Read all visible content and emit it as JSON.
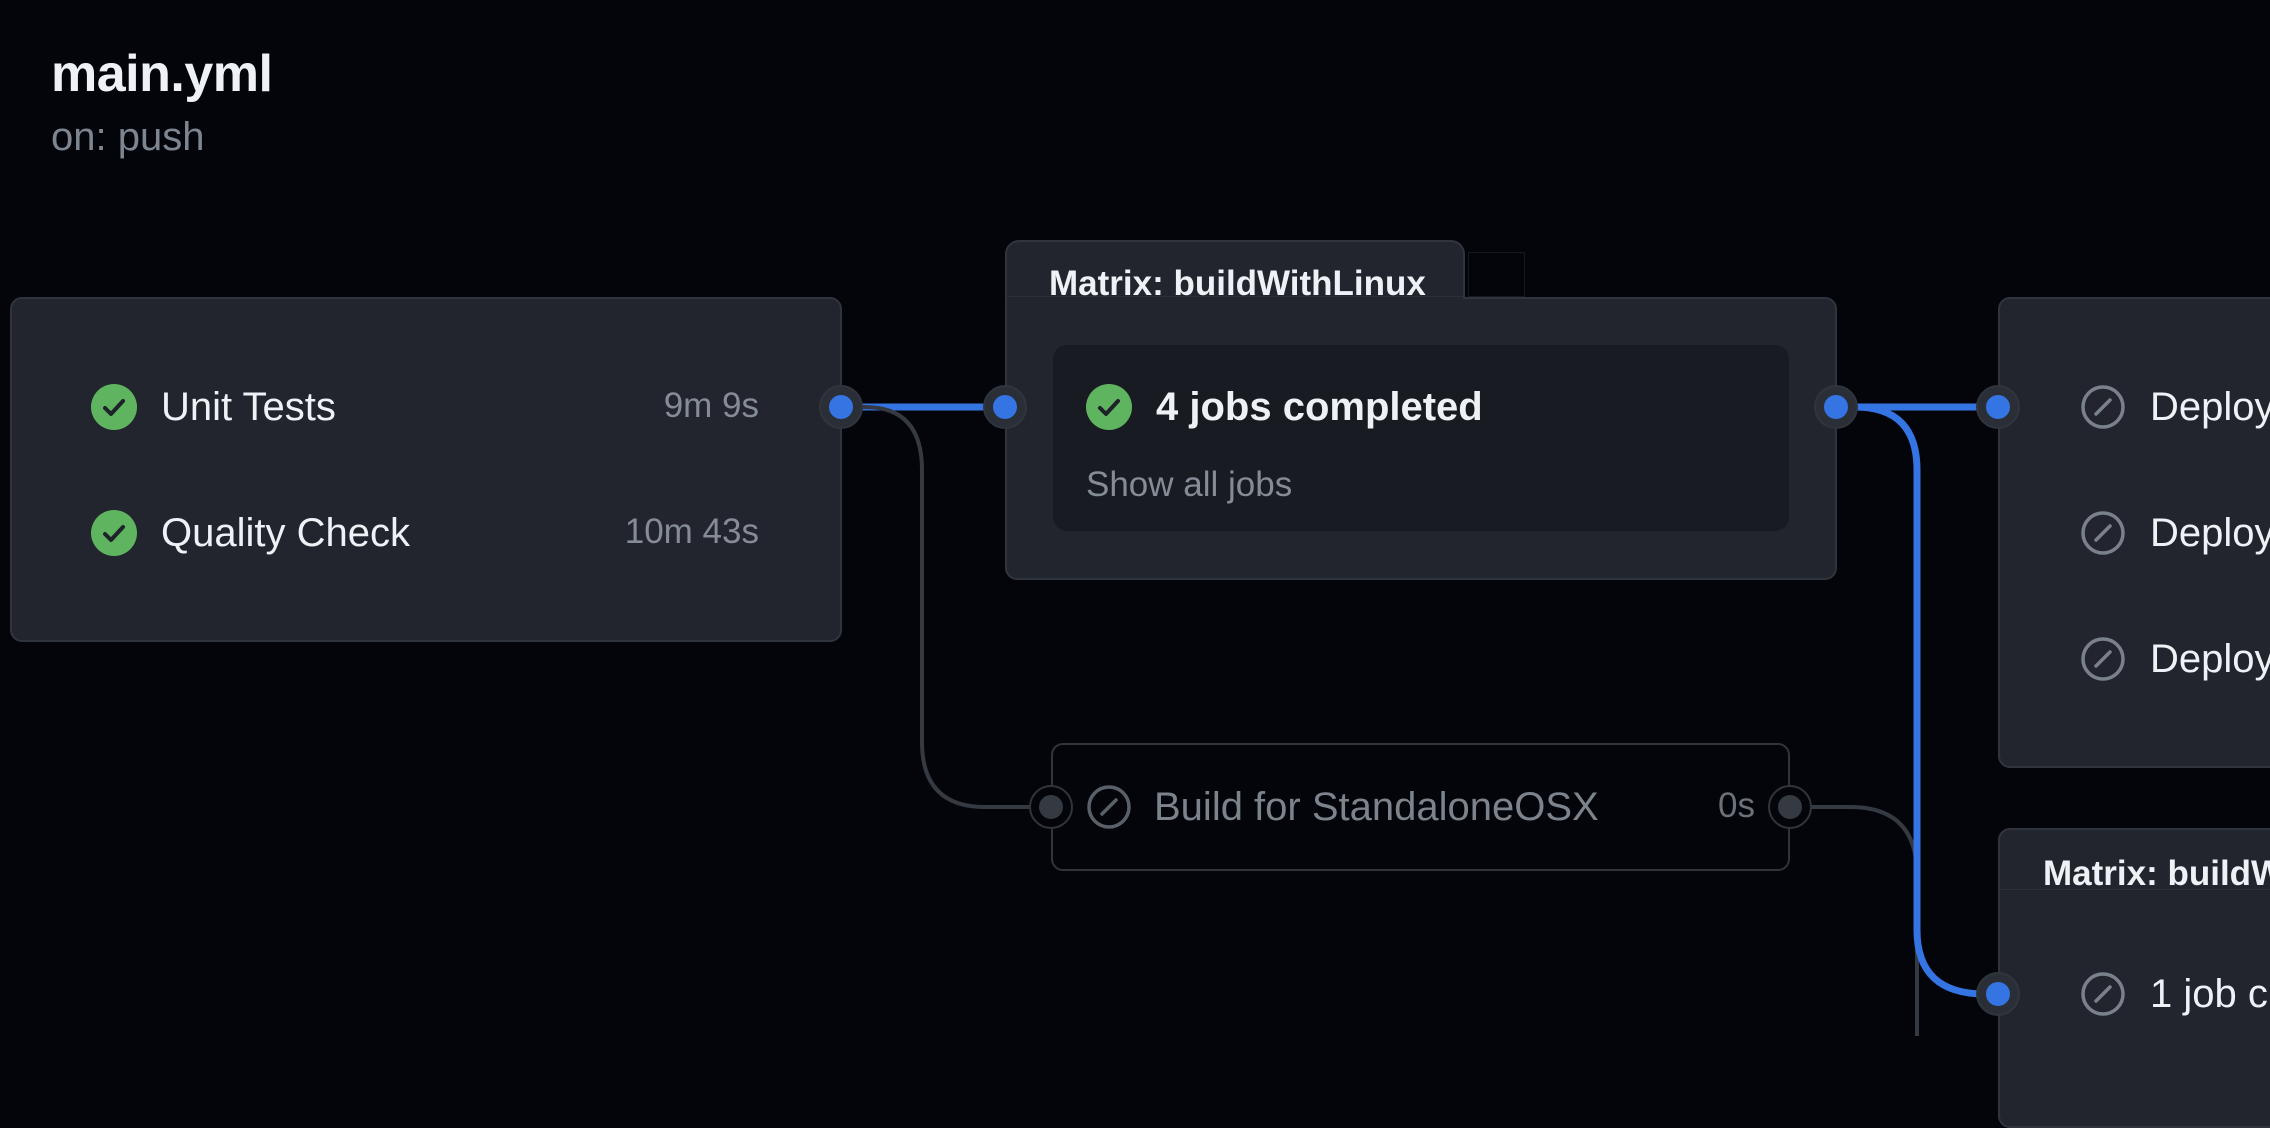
{
  "workflow": {
    "title": "main.yml",
    "trigger": "on: push"
  },
  "colors": {
    "background": "#03050a",
    "card": "#22252d",
    "success": "#5fb55f",
    "active_edge": "#3574e3",
    "inactive_edge": "#353a42",
    "muted_text": "#858c96"
  },
  "jobs_group_tests": {
    "jobs": [
      {
        "name": "Unit Tests",
        "duration": "9m 9s",
        "status": "success",
        "icon": "check-circle-icon"
      },
      {
        "name": "Quality Check",
        "duration": "10m 43s",
        "status": "success",
        "icon": "check-circle-icon"
      }
    ]
  },
  "matrix_linux": {
    "title": "Matrix: buildWithLinux",
    "summary": "4 jobs completed",
    "summary_status": "success",
    "summary_icon": "check-circle-icon",
    "show_all_label": "Show all jobs"
  },
  "build_osx": {
    "name": "Build for StandaloneOSX",
    "duration": "0s",
    "status": "skipped",
    "icon": "skipped-icon"
  },
  "deploy_group": {
    "jobs": [
      {
        "name": "Deploy",
        "status": "skipped",
        "icon": "skipped-icon"
      },
      {
        "name": "Deploy",
        "status": "skipped",
        "icon": "skipped-icon"
      },
      {
        "name": "Deploy",
        "status": "skipped",
        "icon": "skipped-icon"
      }
    ]
  },
  "matrix_bottom": {
    "title": "Matrix: buildW",
    "summary": "1 job c",
    "summary_status": "skipped",
    "summary_icon": "skipped-icon"
  }
}
